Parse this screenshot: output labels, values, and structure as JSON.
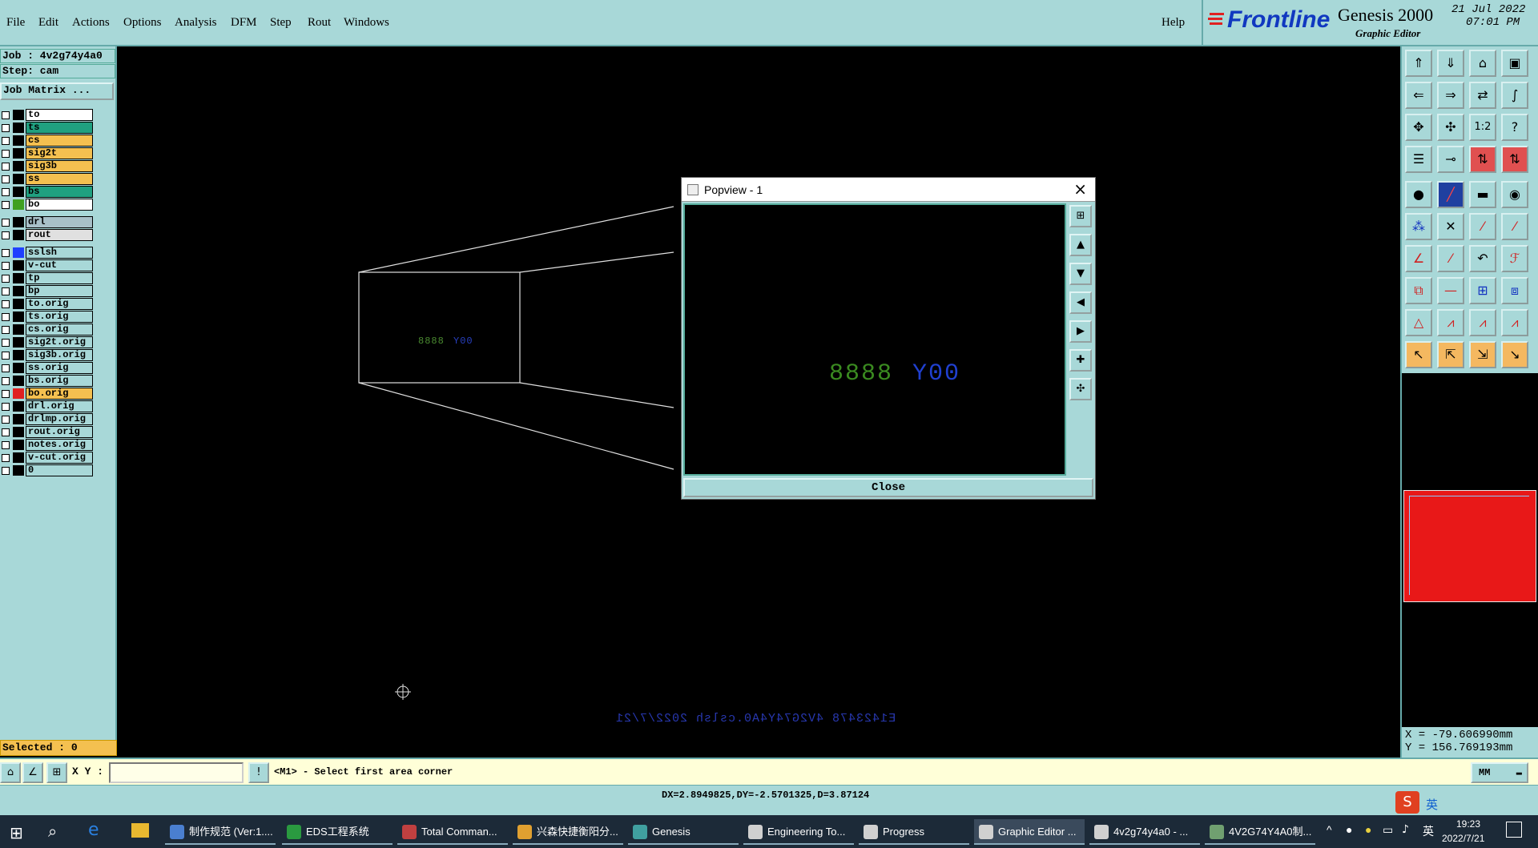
{
  "menu": {
    "items": [
      "File",
      "Edit",
      "Actions",
      "Options",
      "Analysis",
      "DFM",
      "Step",
      "Rout",
      "Windows"
    ],
    "help": "Help"
  },
  "brand": {
    "logo": "Frontline",
    "product": "Genesis 2000",
    "subtitle": "Graphic Editor",
    "date": "21 Jul 2022",
    "time": "07:01 PM"
  },
  "job": {
    "job_label": "Job : 4v2g74y4a0",
    "step_label": "Step: cam",
    "matrix_button": "Job Matrix ..."
  },
  "layers": [
    {
      "name": "to",
      "color": "#ffffff",
      "swatch": "#000000"
    },
    {
      "name": "ts",
      "color": "#20a080",
      "swatch": "#000000"
    },
    {
      "name": "cs",
      "color": "#f4c050",
      "swatch": "#000000"
    },
    {
      "name": "sig2t",
      "color": "#f4c050",
      "swatch": "#000000"
    },
    {
      "name": "sig3b",
      "color": "#f4c050",
      "swatch": "#000000"
    },
    {
      "name": "ss",
      "color": "#f4c050",
      "swatch": "#000000"
    },
    {
      "name": "bs",
      "color": "#20a080",
      "swatch": "#000000"
    },
    {
      "name": "bo",
      "color": "#ffffff",
      "swatch": "#40a020"
    },
    {
      "name": "drl",
      "color": "#a8c0c8",
      "swatch": "#000000"
    },
    {
      "name": "rout",
      "color": "#e0e0e0",
      "swatch": "#000000"
    },
    {
      "name": "sslsh",
      "color": "#a8d8d8",
      "swatch": "#2040ff"
    },
    {
      "name": "v-cut",
      "color": "#a8d8d8",
      "swatch": "#000000"
    },
    {
      "name": "tp",
      "color": "#a8d8d8",
      "swatch": "#000000"
    },
    {
      "name": "bp",
      "color": "#a8d8d8",
      "swatch": "#000000"
    },
    {
      "name": "to.orig",
      "color": "#a8d8d8",
      "swatch": "#000000"
    },
    {
      "name": "ts.orig",
      "color": "#a8d8d8",
      "swatch": "#000000"
    },
    {
      "name": "cs.orig",
      "color": "#a8d8d8",
      "swatch": "#000000"
    },
    {
      "name": "sig2t.orig",
      "color": "#a8d8d8",
      "swatch": "#000000"
    },
    {
      "name": "sig3b.orig",
      "color": "#a8d8d8",
      "swatch": "#000000"
    },
    {
      "name": "ss.orig",
      "color": "#a8d8d8",
      "swatch": "#000000"
    },
    {
      "name": "bs.orig",
      "color": "#a8d8d8",
      "swatch": "#000000"
    },
    {
      "name": "bo.orig",
      "color": "#f4c050",
      "swatch": "#e02020"
    },
    {
      "name": "drl.orig",
      "color": "#a8d8d8",
      "swatch": "#000000"
    },
    {
      "name": "drlmp.orig",
      "color": "#a8d8d8",
      "swatch": "#000000"
    },
    {
      "name": "rout.orig",
      "color": "#a8d8d8",
      "swatch": "#000000"
    },
    {
      "name": "notes.orig",
      "color": "#a8d8d8",
      "swatch": "#000000"
    },
    {
      "name": "v-cut.orig",
      "color": "#a8d8d8",
      "swatch": "#000000"
    },
    {
      "name": "0",
      "color": "#a8d8d8",
      "swatch": "#000000"
    }
  ],
  "selected": "Selected : 0",
  "canvas": {
    "board_text_green": "8888",
    "board_text_blue": "Y00",
    "mirrored_text": "E1423478 4V2G74Y4A0.cslsh 2022/7/21"
  },
  "popview": {
    "title": "Popview - 1",
    "text_green": "8888",
    "text_blue": "Y00",
    "close_label": "Close"
  },
  "coords": {
    "x": "X = -79.606990mm",
    "y": "Y = 156.769193mm"
  },
  "cmd": {
    "xy_label": "X Y :",
    "prompt": "<M1> - Select first area corner",
    "units": "MM"
  },
  "status": "DX=2.8949825,DY=-2.5701325,D=3.87124",
  "taskbar": {
    "items": [
      {
        "label": "制作规范 (Ver:1....",
        "color": "#4a7fd0"
      },
      {
        "label": "EDS工程系统",
        "color": "#2a9a40"
      },
      {
        "label": "Total Comman...",
        "color": "#c04040"
      },
      {
        "label": "兴森快捷衡阳分...",
        "color": "#e0a030"
      },
      {
        "label": "Genesis",
        "color": "#40a0a0"
      },
      {
        "label": "Engineering To...",
        "color": "#d0d0d0"
      },
      {
        "label": "Progress",
        "color": "#d0d0d0"
      },
      {
        "label": "Graphic Editor ...",
        "color": "#d0d0d0"
      },
      {
        "label": "4v2g74y4a0 - ...",
        "color": "#d0d0d0"
      },
      {
        "label": "4V2G74Y4A0制...",
        "color": "#70a070"
      }
    ],
    "ime": "英",
    "clock_time": "19:23",
    "clock_date": "2022/7/21",
    "lang": "英"
  }
}
